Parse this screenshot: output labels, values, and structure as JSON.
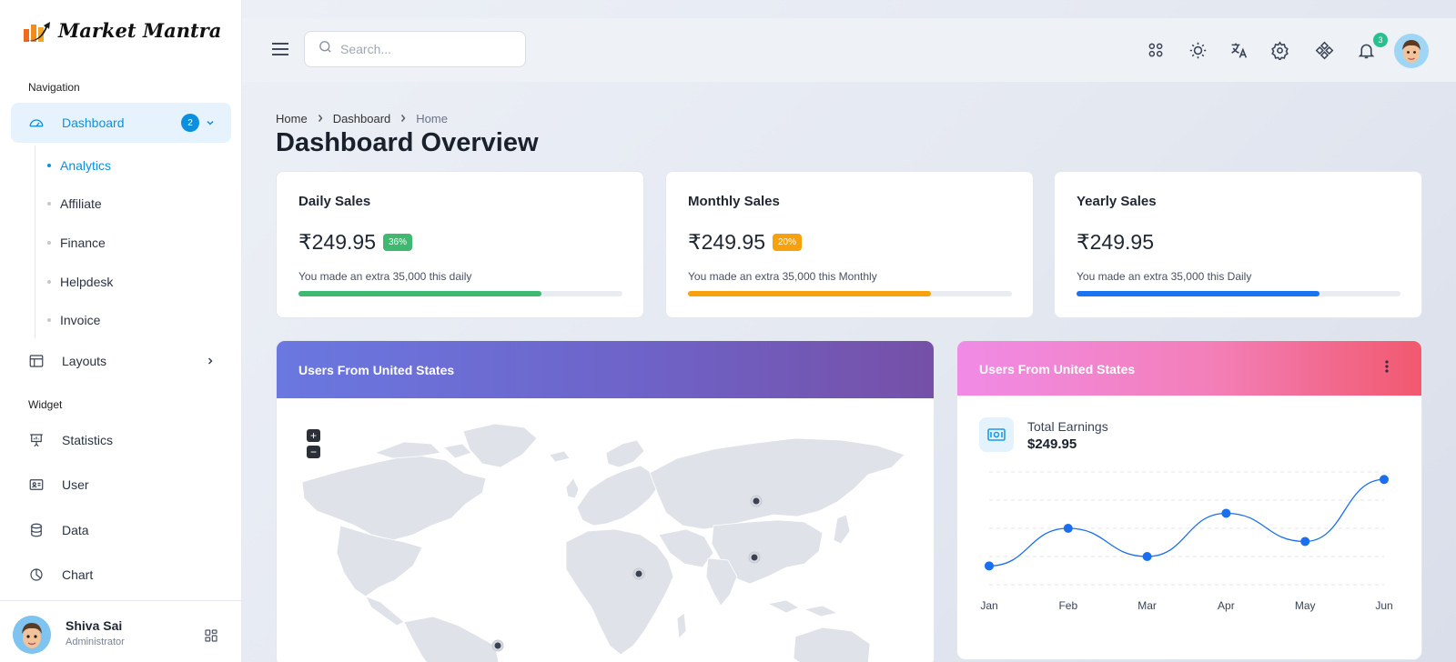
{
  "brand": {
    "name": "Market Mantra"
  },
  "sidebar": {
    "sections": {
      "navigation": "Navigation",
      "widget": "Widget"
    },
    "dashboard": {
      "label": "Dashboard",
      "badge": "2"
    },
    "sub_items": [
      "Analytics",
      "Affiliate",
      "Finance",
      "Helpdesk",
      "Invoice"
    ],
    "layouts": {
      "label": "Layouts"
    },
    "widgets": [
      "Statistics",
      "User",
      "Data",
      "Chart"
    ],
    "user": {
      "name": "Shiva Sai",
      "role": "Administrator"
    }
  },
  "header": {
    "search_placeholder": "Search...",
    "notification_count": "3"
  },
  "breadcrumb": [
    "Home",
    "Dashboard",
    "Home"
  ],
  "page_title": "Dashboard Overview",
  "stats": [
    {
      "title": "Daily Sales",
      "value": "₹249.95",
      "badge": "36%",
      "note": "You made an extra 35,000 this daily",
      "progress": 0.75,
      "color": "#3fb871",
      "badge_color": "#3fb871"
    },
    {
      "title": "Monthly Sales",
      "value": "₹249.95",
      "badge": "20%",
      "note": "You made an extra 35,000 this Monthly",
      "progress": 0.75,
      "color": "#f7a10f",
      "badge_color": "#f7a10f"
    },
    {
      "title": "Yearly Sales",
      "value": "₹249.95",
      "badge": "",
      "note": "You made an extra 35,000 this Daily",
      "progress": 0.75,
      "color": "#1a73f0",
      "badge_color": "#1a73f0"
    }
  ],
  "map_card": {
    "title": "Users From United States",
    "zoom_in": "+",
    "zoom_out": "−"
  },
  "earnings_card": {
    "title": "Users From United States",
    "label": "Total Earnings",
    "value": "$249.95"
  },
  "chart_data": {
    "type": "line",
    "categories": [
      "Jan",
      "Feb",
      "Mar",
      "Apr",
      "May",
      "Jun"
    ],
    "series": [
      {
        "values": [
          10,
          30,
          15,
          38,
          23,
          56
        ]
      }
    ],
    "ylim": [
      0,
      60
    ],
    "grid": true,
    "color": "#1a6ff0"
  }
}
